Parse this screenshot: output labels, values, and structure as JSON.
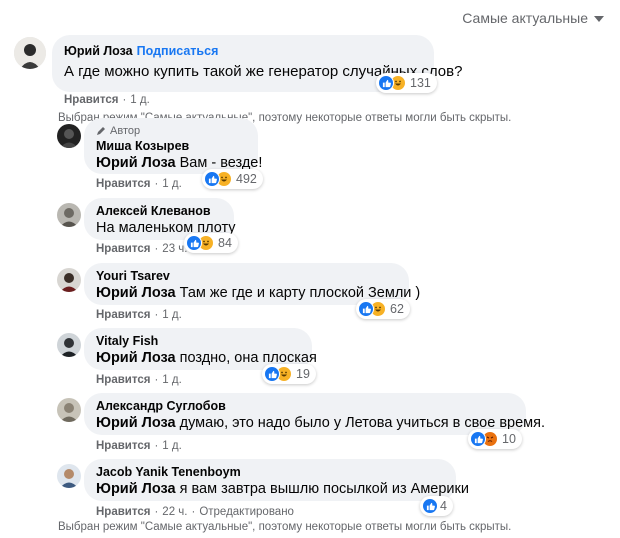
{
  "sort": {
    "label": "Самые актуальные"
  },
  "root": {
    "author": "Юрий Лоза",
    "follow": "Подписаться",
    "text": "А где можно купить такой же генератор случайных слов?",
    "reactions_count": "131",
    "like": "Нравится",
    "time": "1 д."
  },
  "notice_top": "Выбран режим \"Самые актуальные\", поэтому некоторые ответы могли быть скрыты.",
  "replies": [
    {
      "author_tag": "Автор",
      "author": "Миша Козырев",
      "mention": "Юрий Лоза",
      "text": "Вам - везде!",
      "count": "492",
      "like": "Нравится",
      "time": "1 д."
    },
    {
      "author": "Алексей Клеванов",
      "mention": "",
      "text": "На маленьком плоту",
      "count": "84",
      "like": "Нравится",
      "time": "23 ч."
    },
    {
      "author": "Youri Tsarev",
      "mention": "Юрий Лоза",
      "text": "Там же где и карту плоской Земли )",
      "count": "62",
      "like": "Нравится",
      "time": "1 д."
    },
    {
      "author": "Vitaly Fish",
      "mention": "Юрий Лоза",
      "text": "поздно, она плоская",
      "count": "19",
      "like": "Нравится",
      "time": "1 д."
    },
    {
      "author": "Александр Суглобов",
      "mention": "Юрий Лоза",
      "text": "думаю, это надо было у Летова учиться в свое время.",
      "count": "10",
      "like": "Нравится",
      "time": "1 д."
    },
    {
      "author": "Jacob Yanik Tenenboym",
      "mention": "Юрий Лоза",
      "text": "я вам завтра вышлю посылкой из Америки",
      "count": "4",
      "like": "Нравится",
      "time": "22 ч.",
      "extra": "Отредактировано"
    }
  ],
  "notice_bottom": "Выбран режим \"Самые актуальные\", поэтому некоторые ответы могли быть скрыты.",
  "colors": {
    "bubble": "#f0f2f5",
    "link": "#1877f2",
    "meta": "#65676b",
    "like": "#1877f2",
    "haha": "#f7b125",
    "angry": "#e9710f"
  }
}
